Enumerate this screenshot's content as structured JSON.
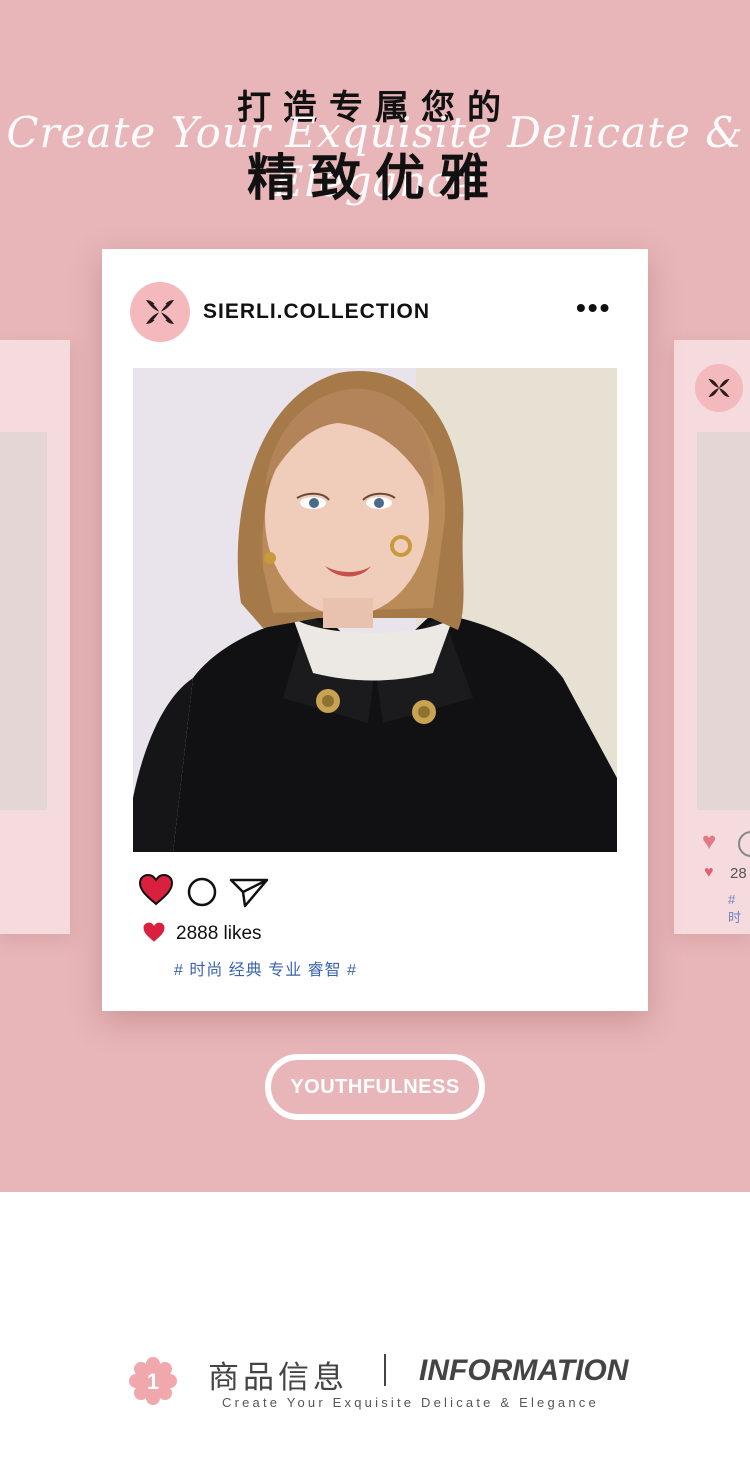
{
  "header": {
    "line1": "打造专属您的",
    "script": "Create Your Exquisite Delicate & Elegance",
    "line2": "精致优雅"
  },
  "post": {
    "account": "SIERLI.COLLECTION",
    "more_label": "•••",
    "likes_text": "2888 likes",
    "hashtags": "# 时尚 经典 专业 睿智 #"
  },
  "side_card": {
    "likes_partial": "28",
    "tag_partial": "# 时"
  },
  "badge": {
    "label": "YOUTHFULNESS"
  },
  "info": {
    "number": "1",
    "cn": "商品信息",
    "en": "INFORMATION",
    "sub": "Create Your Exquisite Delicate & Elegance"
  },
  "colors": {
    "background_pink": "#e8b6b8",
    "logo_pink": "#f4b9bd",
    "heart_red": "#d9213f",
    "tag_blue": "#3c63ad"
  },
  "icons": [
    "logo-icon",
    "more-icon",
    "heart-icon",
    "comment-icon",
    "send-icon",
    "flower-icon"
  ]
}
